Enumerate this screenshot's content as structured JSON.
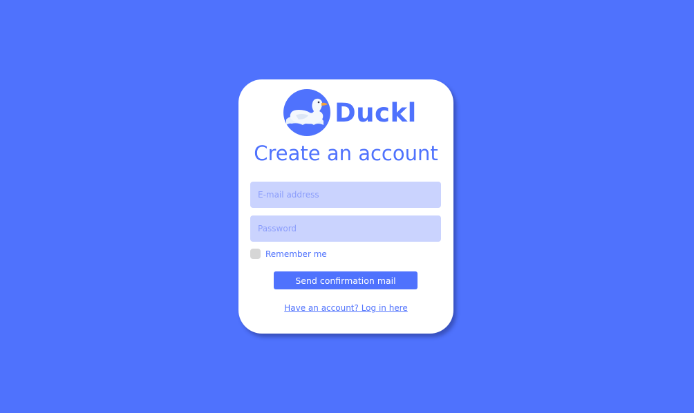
{
  "colors": {
    "background": "#4f72fd",
    "card": "#ffffff",
    "accent": "#4f72fd",
    "field_fill": "#cad3fe",
    "checkbox_fill": "#d6d6d6"
  },
  "brand": {
    "name": "Duckl",
    "logo_icon": "duck-logo-icon"
  },
  "form": {
    "title": "Create an account",
    "email_placeholder": "E-mail address",
    "password_placeholder": "Password",
    "remember_label": "Remember me",
    "remember_checked": false,
    "submit_label": "Send confirmation mail",
    "login_link": "Have an account? Log in here"
  }
}
